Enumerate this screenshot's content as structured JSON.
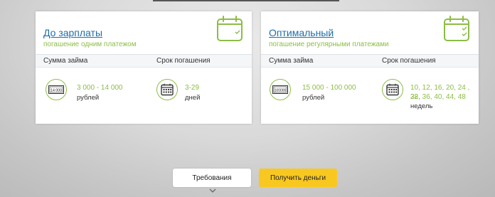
{
  "colors": {
    "accent_green": "#8cbd45",
    "link_blue": "#1f6ea8",
    "button_yellow": "#f9c820"
  },
  "cards": [
    {
      "title": "До зарплаты",
      "subtitle": "погашение одним платежом",
      "amount_label": "Сумма займа",
      "term_label": "Срок погашения",
      "amount_value": "3 000 - 14 000",
      "amount_unit": "рублей",
      "banknote_text": "14 000",
      "term_value": "3-29",
      "term_unit": "дней"
    },
    {
      "title": "Оптимальный",
      "subtitle": "погашение регулярными платежами",
      "amount_label": "Сумма займа",
      "term_label": "Срок погашения",
      "amount_value": "15 000 - 100 000",
      "amount_unit": "рублей",
      "banknote_text": "100000",
      "term_value_line1": "10, 12, 16, 20, 24 , 28,",
      "term_value_line2": "32, 36, 40, 44, 48",
      "term_unit": "недель"
    }
  ],
  "buttons": {
    "requirements": "Требования",
    "get_money": "Получить деньги"
  },
  "icons": [
    "calendar-check-icon",
    "banknote-icon",
    "calendar-grid-icon",
    "chevron-down-icon"
  ]
}
